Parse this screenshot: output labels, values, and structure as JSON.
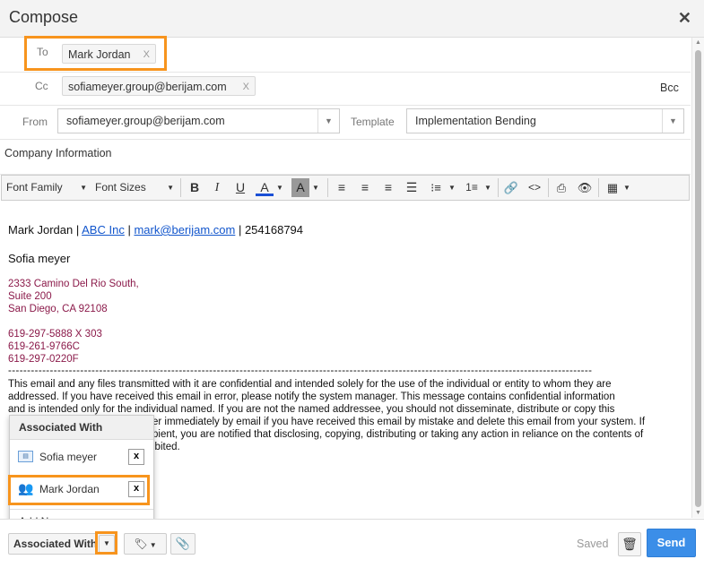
{
  "window": {
    "title": "Compose",
    "close_glyph": "✕"
  },
  "fields": {
    "to_label": "To",
    "to_chips": [
      {
        "name": "Mark Jordan",
        "remove": "X"
      }
    ],
    "cc_label": "Cc",
    "cc_chips": [
      {
        "name": "sofiameyer.group@berijam.com",
        "remove": "X"
      }
    ],
    "bcc_label": "Bcc",
    "from_label": "From",
    "from_value": "sofiameyer.group@berijam.com",
    "template_label": "Template",
    "template_value": "Implementation Bending",
    "subject_value": "Company Information"
  },
  "toolbar": {
    "font_family": "Font Family",
    "font_sizes": "Font Sizes",
    "bold": "B",
    "italic": "I",
    "underline": "U",
    "text_color": "A",
    "bg_color": "A",
    "icons": [
      "align-left-icon",
      "align-center-icon",
      "align-right-icon",
      "align-justify-icon",
      "bullet-list-icon",
      "numbered-list-icon",
      "link-icon",
      "code-icon",
      "print-icon",
      "preview-icon",
      "table-icon"
    ]
  },
  "body": {
    "sig_name": "Mark Jordan",
    "sig_sep1": " | ",
    "sig_company": "ABC Inc",
    "sig_sep2": " | ",
    "sig_email": "mark@berijam.com",
    "sig_sep3": " | ",
    "sig_phone": "254168794",
    "recipient": "Sofia meyer",
    "addr1": "2333 Camino Del Rio South,",
    "addr2": "Suite 200",
    "addr3": "San Diego, CA 92108",
    "phone1": "619-297-5888 X 303",
    "phone2": "619-261-9766C",
    "phone3": "619-297-0220F",
    "divider": "----------------------------------------------------------------------------------------------------------------------------------------------------------",
    "disc1": "This email and any files transmitted with it are confidential and intended solely for the use of the individual or entity to whom they are",
    "disc2": "addressed. If you have received this email in error, please notify the system manager. This message contains confidential information",
    "disc3": "and is intended only for the individual named. If you are not the named addressee, you should not disseminate, distribute or copy this",
    "disc4": "er immediately by email if you have received this email by mistake and delete this email from your system. If",
    "disc5": "pient, you are notified that disclosing, copying, distributing or taking any action in reliance on the contents of",
    "disc6": "ibited."
  },
  "popup": {
    "header": "Associated With",
    "items": [
      {
        "label": "Sofia meyer",
        "remove": "x",
        "icon": "contact-card-icon"
      },
      {
        "label": "Mark Jordan",
        "remove": "x",
        "icon": "people-icon"
      }
    ],
    "add_new": "Add New"
  },
  "footer": {
    "associated_with": "Associated With",
    "saved": "Saved",
    "send": "Send"
  },
  "colors": {
    "highlight": "#f7941d",
    "send": "#3b8ee8",
    "address": "#8b1a4a",
    "link": "#1155cc"
  }
}
